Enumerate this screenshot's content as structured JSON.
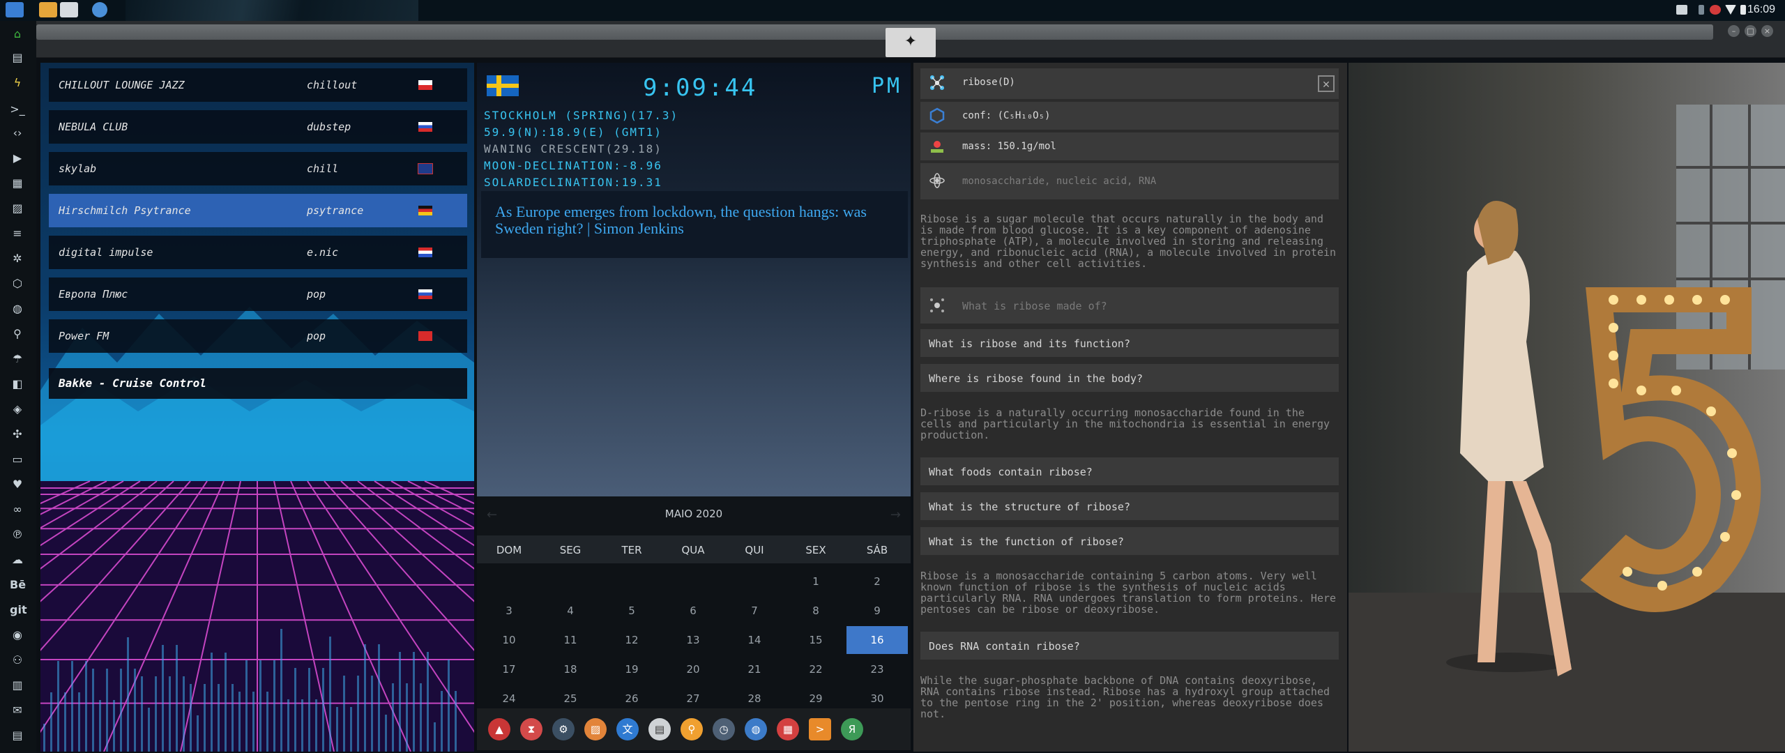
{
  "topbar": {
    "clock": "16:09"
  },
  "radio": {
    "stations": [
      {
        "name": "CHILLOUT LOUNGE JAZZ",
        "genre": "chillout",
        "active": false
      },
      {
        "name": "NEBULA CLUB",
        "genre": "dubstep",
        "active": false
      },
      {
        "name": "skylab",
        "genre": "chill",
        "active": false
      },
      {
        "name": "Hirschmilch Psytrance",
        "genre": "psytrance",
        "active": true
      },
      {
        "name": "digital impulse",
        "genre": "e.nic",
        "active": false
      },
      {
        "name": "Европа Плюс",
        "genre": "pop",
        "active": false
      },
      {
        "name": "Power FM",
        "genre": "pop",
        "active": false
      }
    ],
    "now_playing": "Bakke - Cruise Control"
  },
  "clock_widget": {
    "time": "9:09:44",
    "ampm": "PM",
    "lines": [
      {
        "text": "STOCKHOLM (SPRING)(17.3)",
        "dim": false
      },
      {
        "text": "59.9(N):18.9(E) (GMT1)",
        "dim": false
      },
      {
        "text": "WANING CRESCENT(29.18)",
        "dim": true
      },
      {
        "text": "MOON-DECLINATION:-8.96",
        "dim": false
      },
      {
        "text": "SOLARDECLINATION:19.31",
        "dim": false
      }
    ],
    "news": "As Europe emerges from lockdown, the question hangs: was Sweden right? | Simon Jenkins"
  },
  "calendar": {
    "title": "MAIO 2020",
    "weekdays": [
      "DOM",
      "SEG",
      "TER",
      "QUA",
      "QUI",
      "SEX",
      "SÁB"
    ],
    "weeks": [
      [
        "",
        "",
        "",
        "",
        "",
        "1",
        "2"
      ],
      [
        "3",
        "4",
        "5",
        "6",
        "7",
        "8",
        "9"
      ],
      [
        "10",
        "11",
        "12",
        "13",
        "14",
        "15",
        "16"
      ],
      [
        "17",
        "18",
        "19",
        "20",
        "21",
        "22",
        "23"
      ],
      [
        "24",
        "25",
        "26",
        "27",
        "28",
        "29",
        "30"
      ]
    ],
    "today": "16"
  },
  "chem": {
    "title": "ribose(D)",
    "conf": "conf: (C₅H₁₀O₅)",
    "mass": "mass: 150.1g/mol",
    "tags": "monosaccharide, nucleic acid, RNA",
    "para1": "Ribose is a sugar molecule that occurs naturally in the body and is made from blood glucose. It is a key component of adenosine triphosphate (ATP), a molecule involved in storing and releasing energy, and ribonucleic acid (RNA), a molecule involved in protein synthesis and other cell activities.",
    "q1": "What is ribose made of?",
    "q2": "What is ribose and its function?",
    "q3": "Where is ribose found in the body?",
    "para2": "D-ribose is a naturally occurring monosaccharide found in the cells and particularly in the mitochondria is essential in energy production.",
    "q4": "What foods contain ribose?",
    "q5": "What is the structure of ribose?",
    "q6": "What is the function of ribose?",
    "para3": "Ribose is a monosaccharide containing 5 carbon atoms. Very well known function of ribose is the synthesis of nucleic acids particularly RNA. RNA undergoes translation to form proteins. Here pentoses can be ribose or deoxyribose.",
    "q7": "Does RNA contain ribose?",
    "para4": "While the sugar-phosphate backbone of DNA contains deoxyribose, RNA contains ribose instead. Ribose has a hydroxyl group attached to the pentose ring in the 2' position, whereas deoxyribose does not."
  },
  "colors": {
    "accent_cyan": "#38c4f0",
    "selection_blue": "#2d62b4",
    "today_blue": "#3e78c9"
  },
  "icons": {
    "launcher": [
      "anbox-icon",
      "hourglass-icon",
      "steam-icon",
      "image-viewer-icon",
      "translate-icon",
      "news-icon",
      "search-icon",
      "clock-icon",
      "globe-icon",
      "calendar-icon",
      "terminal-icon",
      "yandex-icon"
    ]
  }
}
